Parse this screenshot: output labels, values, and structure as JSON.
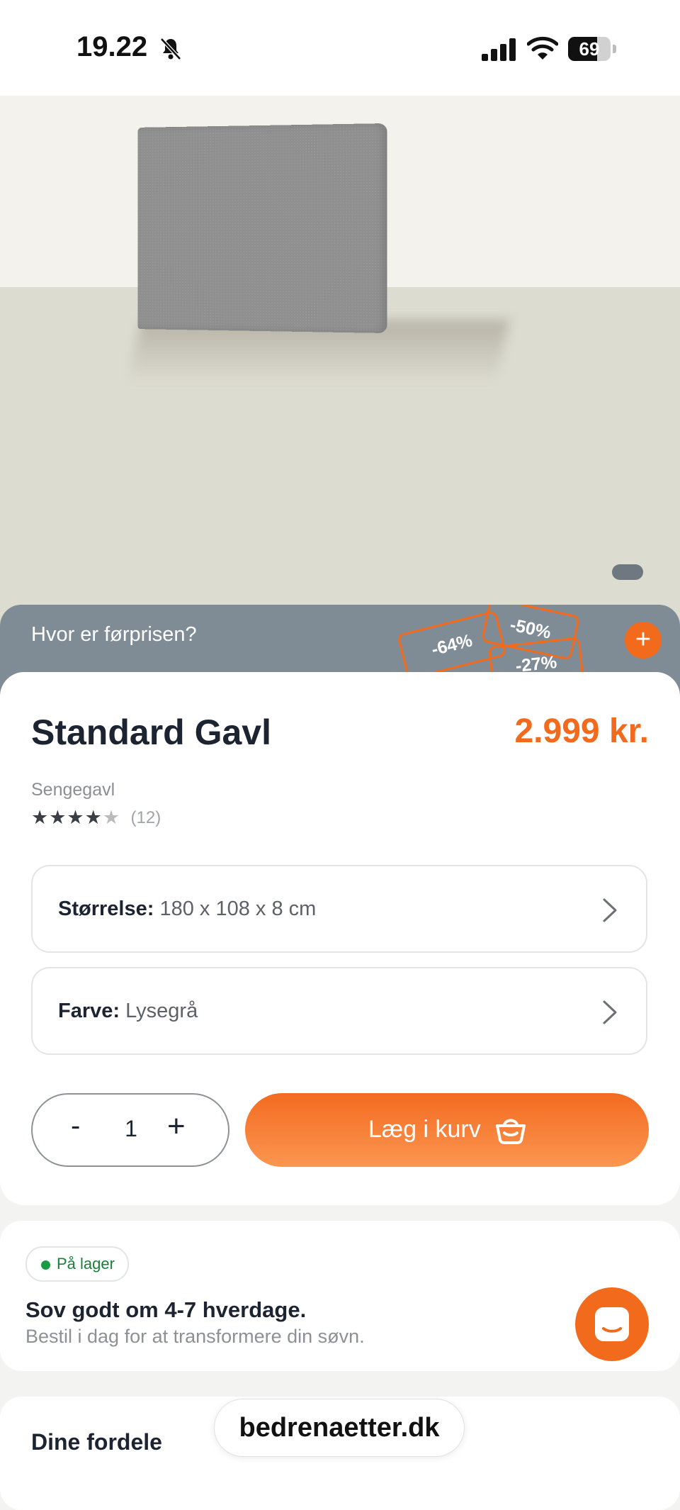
{
  "status_bar": {
    "time": "19.22",
    "battery_level": "69",
    "icons": [
      "bell-slash-icon",
      "signal-icon",
      "wifi-icon",
      "battery-icon"
    ]
  },
  "promo": {
    "question": "Hvor er førprisen?",
    "tags": [
      "-64%",
      "-50%",
      "-27%"
    ],
    "plus_label": "+"
  },
  "product": {
    "title": "Standard Gavl",
    "price": "2.999 kr.",
    "category": "Sengegavl",
    "rating_value": 4.5,
    "rating_count": "(12)",
    "options": {
      "size_label": "Størrelse:",
      "size_value": "180 x 108 x 8 cm",
      "color_label": "Farve:",
      "color_value": "Lysegrå"
    },
    "quantity": {
      "minus": "-",
      "value": "1",
      "plus": "+"
    },
    "add_to_cart_label": "Læg i kurv"
  },
  "stock": {
    "badge": "På lager",
    "headline": "Sov godt om 4-7 hverdage.",
    "subline": "Bestil i dag for at transformere din søvn."
  },
  "benefits": {
    "title": "Dine fordele"
  },
  "browser": {
    "url": "bedrenaetter.dk"
  },
  "colors": {
    "accent": "#f26a1c",
    "banner": "#7f8c96",
    "text": "#1b2430",
    "in_stock": "#1a9a44"
  }
}
